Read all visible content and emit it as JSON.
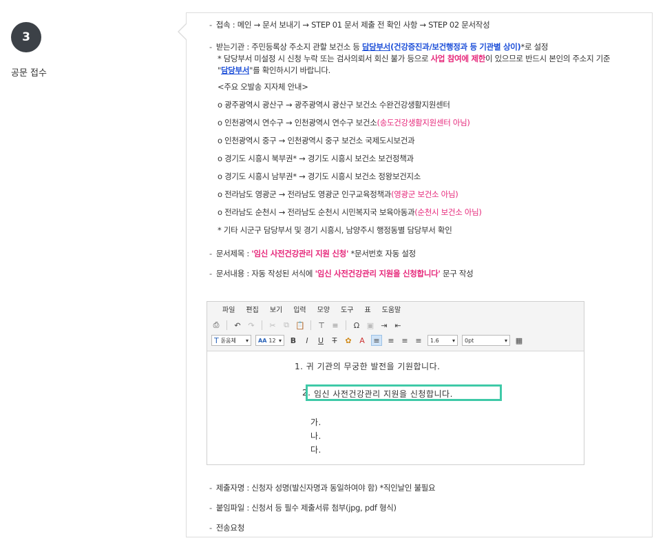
{
  "step": {
    "number": "3",
    "label": "공문 접수"
  },
  "items": {
    "connect": {
      "dash": "-",
      "text": "접속 : 메인 → 문서 보내기 → STEP 01 문서 제출 전 확인 사항 → STEP 02 문서작성"
    },
    "recipient": {
      "dash": "-",
      "prefix": "받는기관 : 주민등록상 주소지 관할 보건소 등 ",
      "link": "담당부서",
      "blue_suffix": "(건강증진과/보건행정과 등 기관별 상이)",
      "suffix": "*로 설정"
    },
    "notice": {
      "prefix": "* 담당부서 미설정 시 신청 누락 또는 검사의뢰서 회신 불가 등으로 ",
      "pink": "사업 참여에 제한",
      "suffix": "이 있으므로 반드시 본인의 주소지 기준"
    },
    "notice2": {
      "q1": "\"",
      "link": "담당부서",
      "suffix": "\"를 확인하시기 바랍니다."
    },
    "guide_title": "<주요 오발송 지자체 안내>",
    "guide": [
      {
        "text": "o 광주광역시 광산구 → 광주광역시 광산구 보건소 수완건강생활지원센터",
        "pink": ""
      },
      {
        "text": "o 인천광역시 연수구 → 인천광역시 연수구 보건소",
        "pink": "(송도건강생활지원센터 아님)"
      },
      {
        "text": "o 인천광역시 중구 → 인천광역시 중구 보건소 국제도시보건과",
        "pink": ""
      },
      {
        "text": "o 경기도 시흥시 북부권* → 경기도 시흥시 보건소 보건정책과",
        "pink": ""
      },
      {
        "text": "o 경기도 시흥시 남부권* → 경기도 시흥시 보건소 정왕보건지소",
        "pink": ""
      },
      {
        "text": "o 전라남도 영광군 → 전라남도 영광군 인구교육정책과",
        "pink": "(영광군 보건소 아님)"
      },
      {
        "text": "o 전라남도 순천시 → 전라남도 순천시 시민복지국 보육아동과",
        "pink": "(순천시 보건소 아님)"
      }
    ],
    "guide_note": "* 기타 시군구 담당부서 및 경기 시흥시, 남양주시 행정동별 담당부서 확인",
    "title": {
      "dash": "-",
      "prefix": "문서제목 : ",
      "quoted": "'임신 사전건강관리 지원 신청'",
      "suffix": " *문서번호 자동 설정"
    },
    "content": {
      "dash": "-",
      "prefix": "문서내용 : 자동 작성된 서식에 ",
      "quoted": "'임신 사전건강관리 지원을 신청합니다'",
      "suffix": " 문구 작성"
    },
    "submitter": {
      "dash": "-",
      "text": "제출자명 : 신청자 성명(발신자명과 동일하여야 함) *직인날인 불필요"
    },
    "attach": {
      "dash": "-",
      "text": "붙임파일 : 신청서 등 필수 제출서류 첨부(jpg, pdf 형식)"
    },
    "send": {
      "dash": "-",
      "text": "전송요청"
    }
  },
  "editor": {
    "menu": [
      "파일",
      "편집",
      "보기",
      "입력",
      "모양",
      "도구",
      "표",
      "도움말"
    ],
    "font_select": "돋움체",
    "size_select": "12",
    "size_prefix": "AA",
    "line_height_select": "1.6",
    "letter_spacing_select": "0pt",
    "bold": "B",
    "italic": "I",
    "underline": "U",
    "strike": "T",
    "omega": "Ω",
    "lines": {
      "l1": "1. 귀 기관의 무궁한 발전을 기원합니다.",
      "l2_num": "2.",
      "l2_text": "임신 사전건강관리 지원을 신청합니다.",
      "ga": "가.",
      "na": "나.",
      "da": "다."
    }
  },
  "colors": {
    "badge": "#3c4147",
    "link_blue": "#1d4fd8",
    "pink": "#e6277a",
    "highlight": "#3ec9a7"
  }
}
